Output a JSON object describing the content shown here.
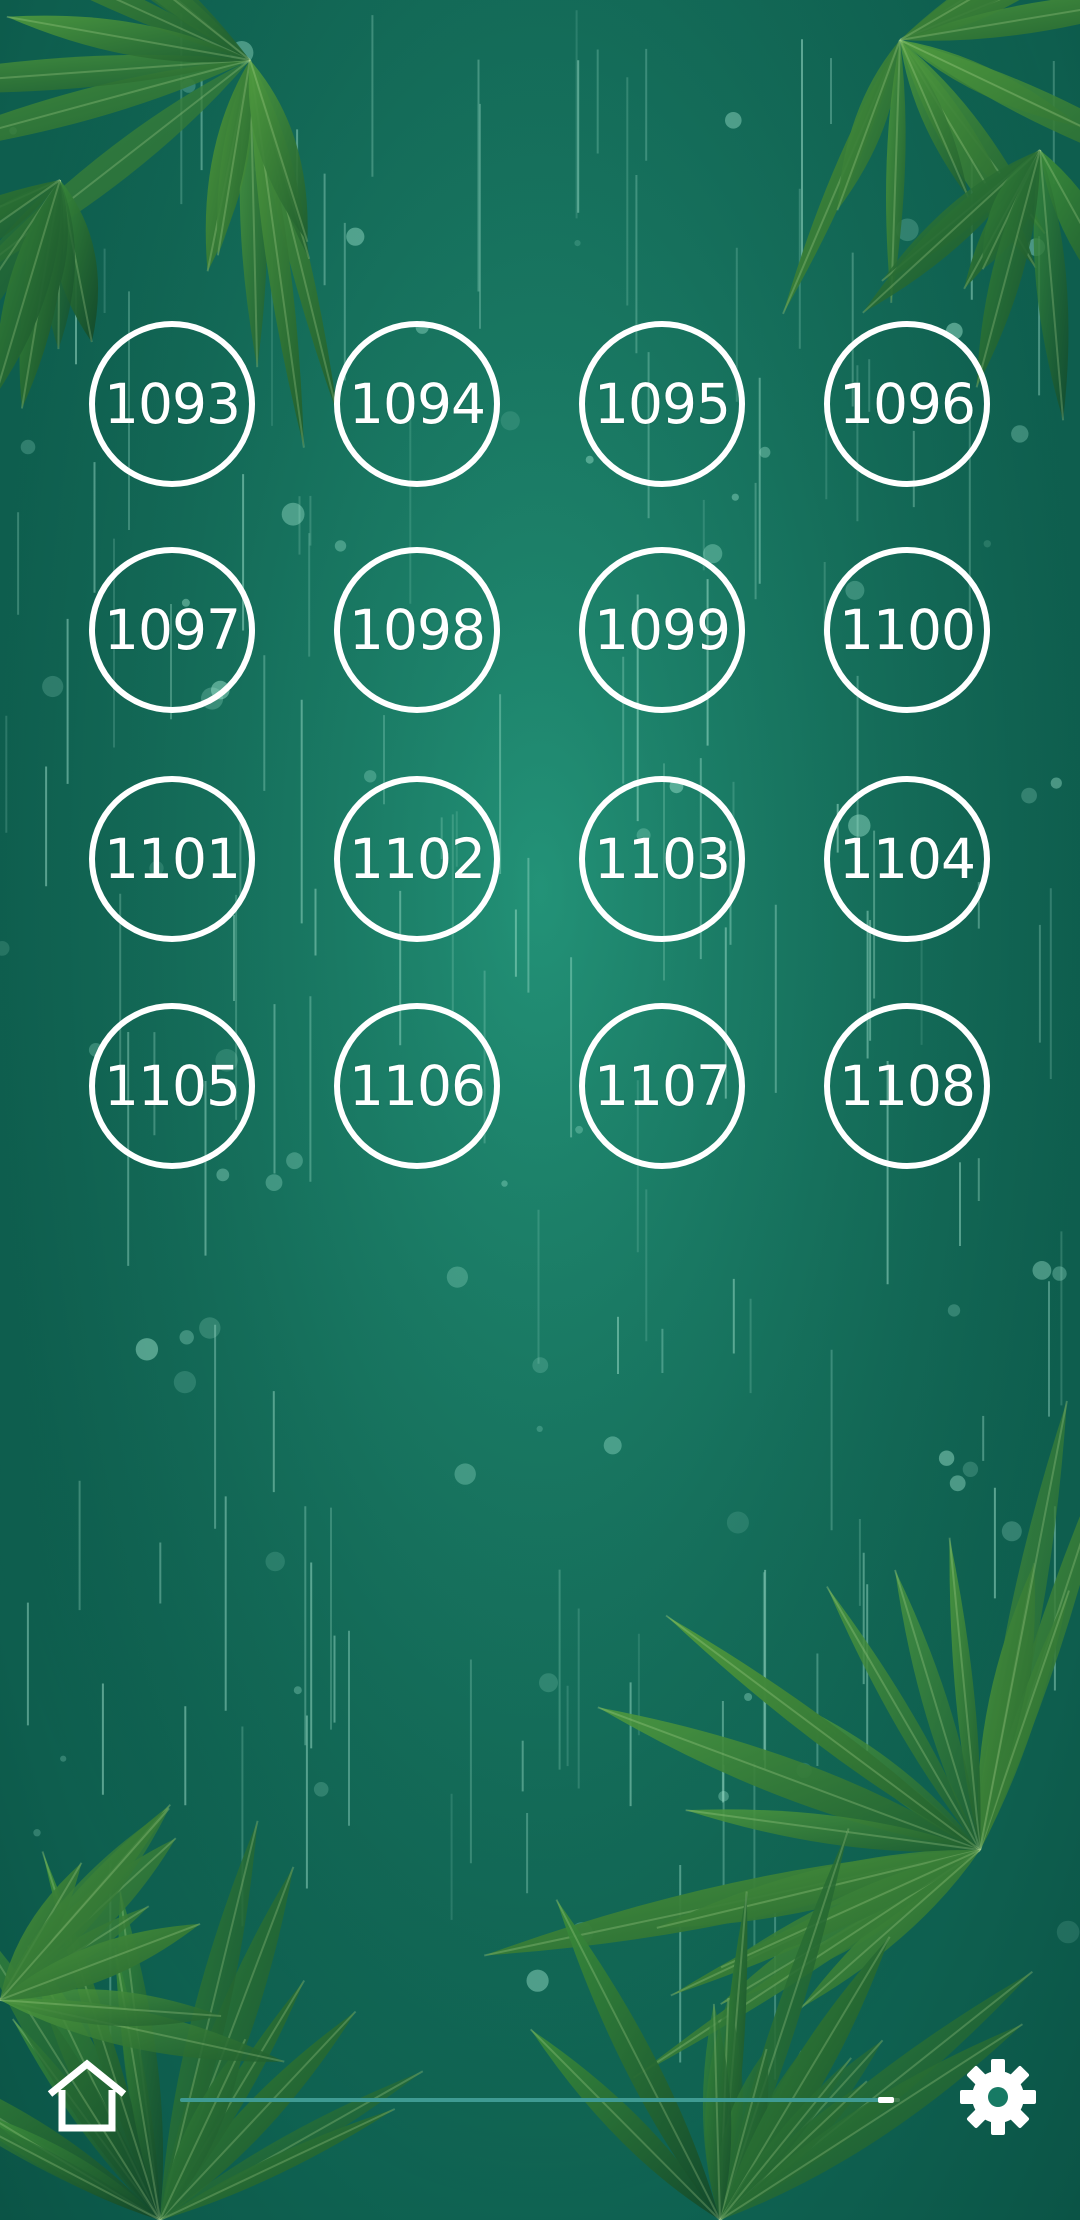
{
  "levels": [
    "1093",
    "1094",
    "1095",
    "1096",
    "1097",
    "1098",
    "1099",
    "1100",
    "1101",
    "1102",
    "1103",
    "1104",
    "1105",
    "1106",
    "1107",
    "1108"
  ],
  "bottom_bar": {
    "home_icon": "home-icon",
    "settings_icon": "gear-icon",
    "progress": 0.98
  },
  "colors": {
    "background": "#177a64",
    "leaf": "#2f7d3b",
    "button_ring": "#ffffff",
    "progress_line": "#3f9b93"
  }
}
